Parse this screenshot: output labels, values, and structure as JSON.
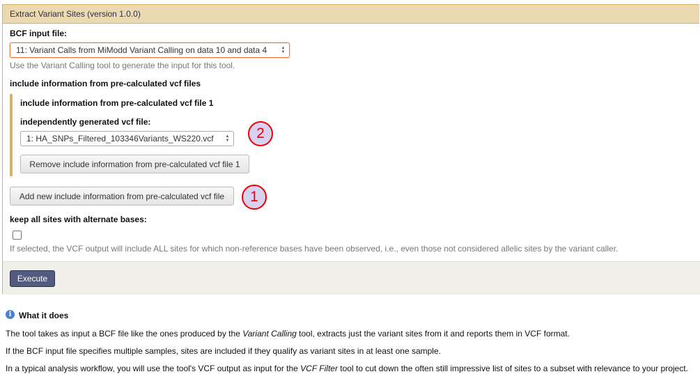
{
  "panel": {
    "title": "Extract Variant Sites (version 1.0.0)"
  },
  "bcf": {
    "label": "BCF input file:",
    "value": "11: Variant Calls from MiModd Variant Calling on data 10 and data 4",
    "help": "Use the Variant Calling tool to generate the input for this tool."
  },
  "precalc": {
    "section_title": "include information from pre-calculated vcf files",
    "item_title": "include information from pre-calculated vcf file 1",
    "vcf_label": "independently generated vcf file:",
    "vcf_value": "1: HA_SNPs_Filtered_103346Variants_WS220.vcf",
    "remove_label": "Remove include information from pre-calculated vcf file 1",
    "add_label": "Add new include information from pre-calculated vcf file"
  },
  "markers": {
    "one": "1",
    "two": "2"
  },
  "keep": {
    "label": "keep all sites with alternate bases:",
    "help": "If selected, the VCF output will include ALL sites for which non-reference bases have been observed, i.e., even those not considered allelic sites by the variant caller."
  },
  "execute_label": "Execute",
  "help_section": {
    "icon": "i",
    "title": "What it does",
    "p1": {
      "a": "The tool takes as input a BCF file like the ones produced by the ",
      "em": "Variant Calling",
      "b": " tool, extracts just the variant sites from it and reports them in VCF format."
    },
    "p2": "If the BCF input file specifies multiple samples, sites are included if they qualify as variant sites in at least one sample.",
    "p3": {
      "a": "In a typical analysis workflow, you will use the tool's VCF output as input for the ",
      "em": "VCF Filter",
      "b": " tool to cut down the often still impressive list of sites to a subset with relevance to your project."
    }
  }
}
